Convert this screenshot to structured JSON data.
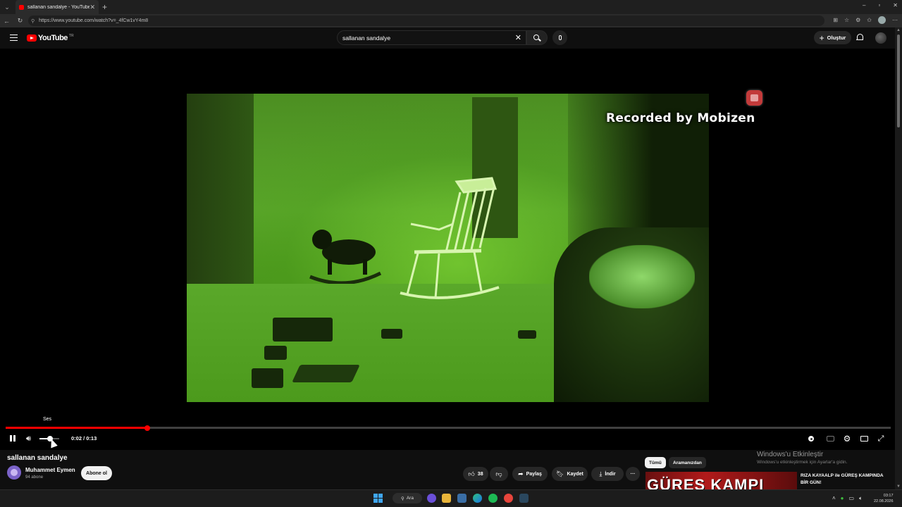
{
  "browser": {
    "tab_title": "sallanan sandalye - YouTube",
    "tab_close": "✕",
    "new_tab": "+",
    "url": "https://www.youtube.com/watch?v=_4fCw1vY4m8",
    "window_controls": [
      "–",
      "▫",
      "✕"
    ]
  },
  "youtube": {
    "logo_text": "YouTube",
    "country_code": "TR",
    "search_value": "sallanan sandalye",
    "create_label": "Oluştur"
  },
  "player": {
    "watermark": "Recorded by Mobizen",
    "tooltip": "Ses",
    "current_time": "0:02",
    "duration": "0:13",
    "time_display": "0:02 / 0:13",
    "progress_fraction": 0.16,
    "volume_fraction": 0.55
  },
  "video": {
    "title": "sallanan sandalye",
    "channel_name": "Muhammet Eymen",
    "subscribers": "94 abone",
    "subscribe_label": "Abone ol",
    "likes": "38",
    "share_label": "Paylaş",
    "save_label": "Kaydet",
    "download_label": "İndir",
    "more_label": "···"
  },
  "related": {
    "chips": [
      "Tümü",
      "Aramanızdan"
    ],
    "rec_thumb_text": "GÜREŞ KAMPI",
    "rec_title": "RIZA KAYAALP ile GÜREŞ KAMPINDA BİR GÜN!"
  },
  "windows_activation": {
    "title": "Windows'u Etkinleştir",
    "subtitle": "Windows'u etkinleştirmek için Ayarlar'a gidin."
  },
  "taskbar": {
    "search_label": "Ara",
    "time": "03:17",
    "date": "22.08.2026"
  },
  "colors": {
    "yt_red": "#ff0000",
    "background": "#0f0f0f",
    "night_vision_green": "#5aa52a"
  }
}
